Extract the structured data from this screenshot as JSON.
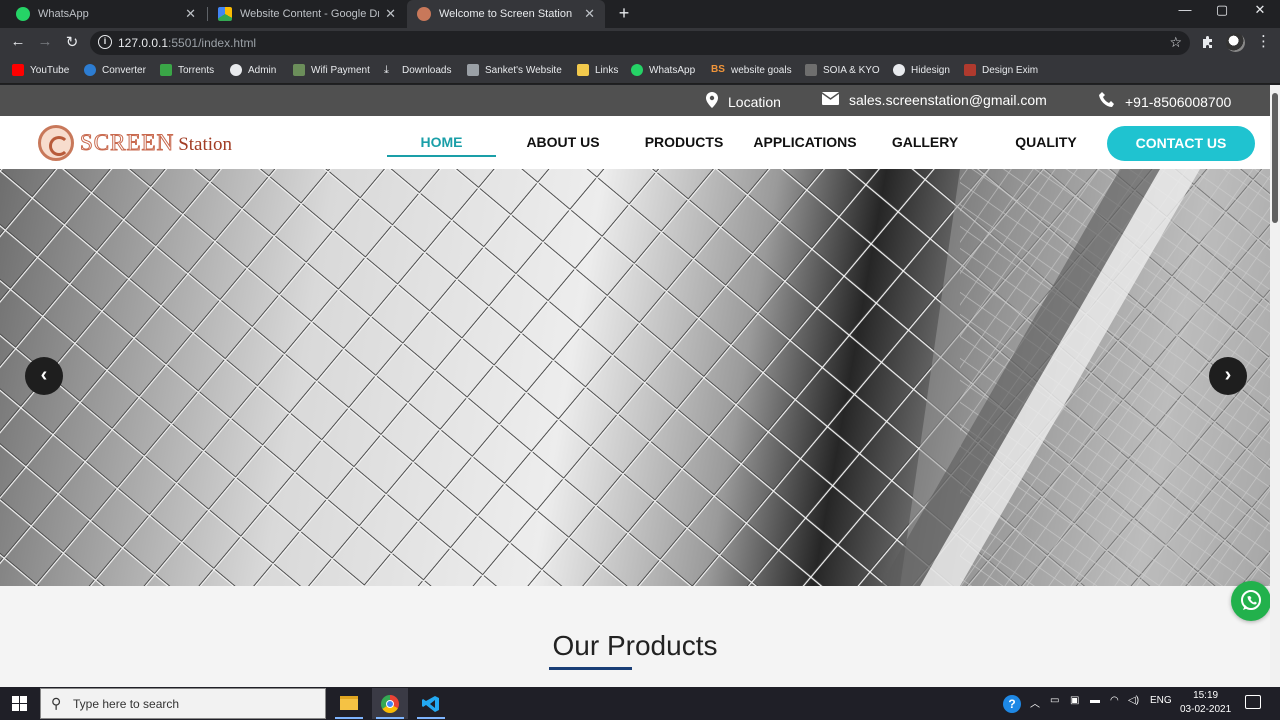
{
  "browser": {
    "tabs": [
      {
        "title": "WhatsApp",
        "active": false
      },
      {
        "title": "Website Content - Google Drive",
        "active": false
      },
      {
        "title": "Welcome to Screen Station",
        "active": true
      }
    ],
    "new_tab_label": "+",
    "window_controls": {
      "minimize": "—",
      "maximize": "▢",
      "close": "✕"
    },
    "url_host": "127.0.0.1",
    "url_rest": ":5501/index.html",
    "bookmarks": [
      {
        "label": "YouTube",
        "icon": "youtube-icon"
      },
      {
        "label": "Converter",
        "icon": "converter-icon"
      },
      {
        "label": "Torrents",
        "icon": "torrents-icon"
      },
      {
        "label": "Admin",
        "icon": "globe-icon"
      },
      {
        "label": "Wifi Payment",
        "icon": "wifi-payment-icon"
      },
      {
        "label": "Downloads",
        "icon": "download-icon"
      },
      {
        "label": "Sanket's Website",
        "icon": "home-icon"
      },
      {
        "label": "Links",
        "icon": "folder-icon"
      },
      {
        "label": "WhatsApp",
        "icon": "whatsapp-icon"
      },
      {
        "label": "website goals",
        "icon": "bs-icon"
      },
      {
        "label": "SOIA & KYO",
        "icon": "soia-icon"
      },
      {
        "label": "Hidesign",
        "icon": "globe-icon"
      },
      {
        "label": "Design Exim",
        "icon": "design-exim-icon"
      }
    ]
  },
  "site": {
    "topbar": {
      "location": "Location",
      "email": "sales.screenstation@gmail.com",
      "phone": "+91-8506008700"
    },
    "logo": {
      "screen": "SCREEN",
      "station": "Station"
    },
    "nav": [
      {
        "label": "HOME",
        "active": true
      },
      {
        "label": "ABOUT US",
        "active": false
      },
      {
        "label": "PRODUCTS",
        "active": false
      },
      {
        "label": "APPLICATIONS",
        "active": false
      },
      {
        "label": "GALLERY",
        "active": false
      },
      {
        "label": "QUALITY",
        "active": false
      }
    ],
    "contact_button": "CONTACT US",
    "carousel": {
      "prev": "‹",
      "next": "›",
      "image": "wire-mesh-photo"
    },
    "section_title": "Our Products"
  },
  "taskbar": {
    "search_placeholder": "Type here to search",
    "apps": [
      "file-explorer-icon",
      "chrome-icon",
      "vscode-icon"
    ],
    "language": "ENG",
    "time": "15:19",
    "date": "03-02-2021"
  },
  "colors": {
    "accent": "#1a9fa8",
    "contact_button": "#1fc3d0",
    "topbar_bg": "#505050",
    "title_underline": "#1a3e76",
    "whatsapp_green": "#22b14c"
  }
}
